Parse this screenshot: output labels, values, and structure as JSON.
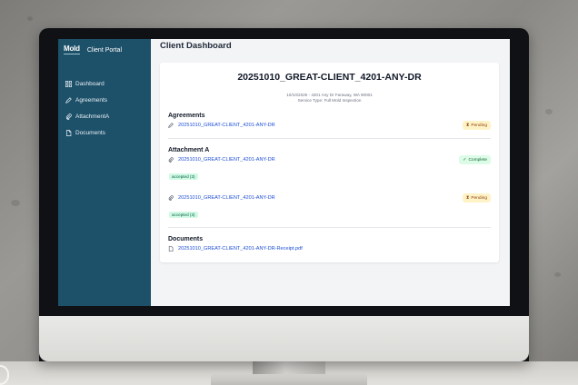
{
  "sidebar": {
    "logo_text": "Mold",
    "app_title": "Client Portal",
    "items": [
      {
        "label": "Dashboard",
        "icon": "grid-icon"
      },
      {
        "label": "Agreements",
        "icon": "pen-icon"
      },
      {
        "label": "AttachmentA",
        "icon": "paperclip-icon"
      },
      {
        "label": "Documents",
        "icon": "document-icon"
      }
    ]
  },
  "main": {
    "page_title": "Client Dashboard",
    "job": {
      "title": "20251010_GREAT-CLIENT_4201-ANY-DR",
      "date_address": "10/10/2025 - 4201 Any Dr Faraway, WA 90001",
      "service_type": "Service Type: Full Mold Inspection"
    },
    "agreements": {
      "title": "Agreements",
      "items": [
        {
          "name": "20251010_GREAT-CLIENT_4201-ANY-DR",
          "status": "Pending"
        }
      ]
    },
    "attachment_a": {
      "title": "Attachment A",
      "items": [
        {
          "name": "20251010_GREAT-CLIENT_4201-ANY-DR",
          "status": "Complete",
          "sub": "accepted (3)"
        },
        {
          "name": "20251010_GREAT-CLIENT_4201-ANY-DR",
          "status": "Pending",
          "sub": "accepted (3)"
        }
      ]
    },
    "documents": {
      "title": "Documents",
      "items": [
        {
          "name": "20251010_GREAT-CLIENT_4201-ANY-DR-Receipt.pdf"
        }
      ]
    }
  },
  "colors": {
    "sidebar": "#1d5069",
    "link": "#1d4ed8",
    "pending_bg": "#fef3c7",
    "complete_bg": "#dcfce7"
  }
}
